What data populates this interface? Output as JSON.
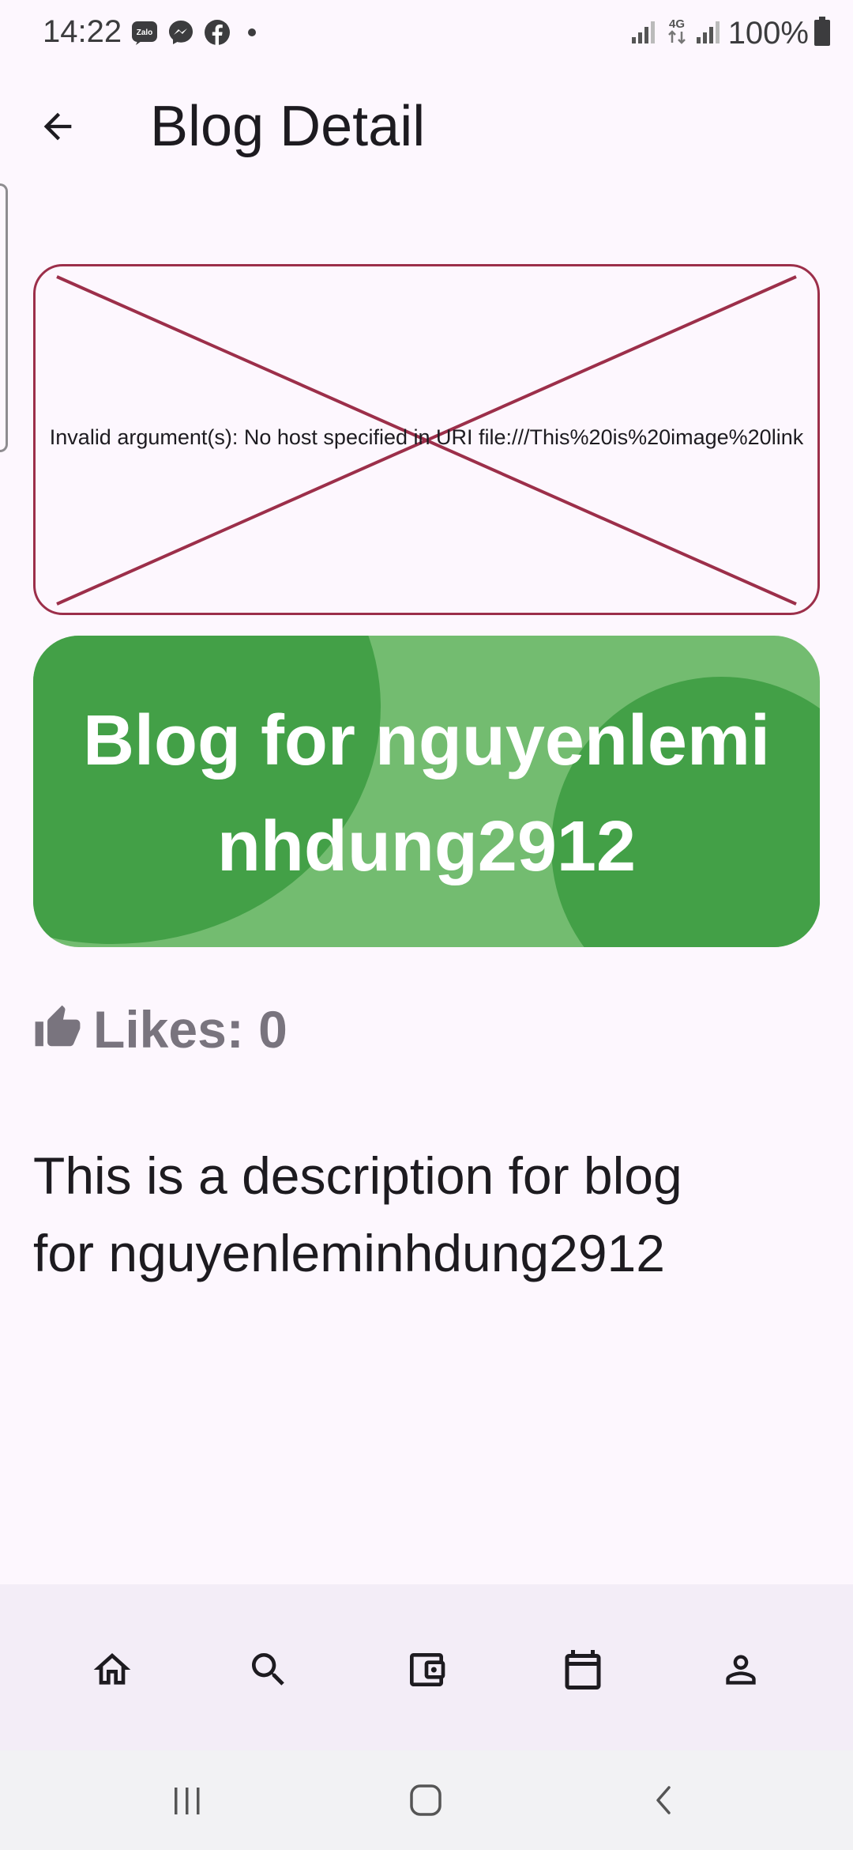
{
  "status_bar": {
    "time": "14:22",
    "battery": "100%",
    "notification_icons": [
      "zalo-icon",
      "messenger-icon",
      "facebook-icon",
      "dot-icon"
    ],
    "zalo_label": "Zalo",
    "network_label": "4G"
  },
  "app_bar": {
    "title": "Blog Detail"
  },
  "image_error": {
    "message": "Invalid argument(s): No host specified in URI file:///This%20is%20image%20link",
    "color": "#9c2f4a"
  },
  "banner": {
    "title": "Blog for nguyenleminhdung2912",
    "bg_color": "#73bc70",
    "accent_color": "#43a047"
  },
  "likes": {
    "label": "Likes: 0",
    "icon": "thumbs-up-icon"
  },
  "description": "This is a description for blog for nguyenleminhdung2912",
  "bottom_nav": {
    "items": [
      "home-icon",
      "search-icon",
      "wallet-icon",
      "calendar-icon",
      "profile-icon"
    ]
  },
  "system_nav": {
    "items": [
      "recent-apps-icon",
      "home-circle-icon",
      "back-chevron-icon"
    ]
  }
}
